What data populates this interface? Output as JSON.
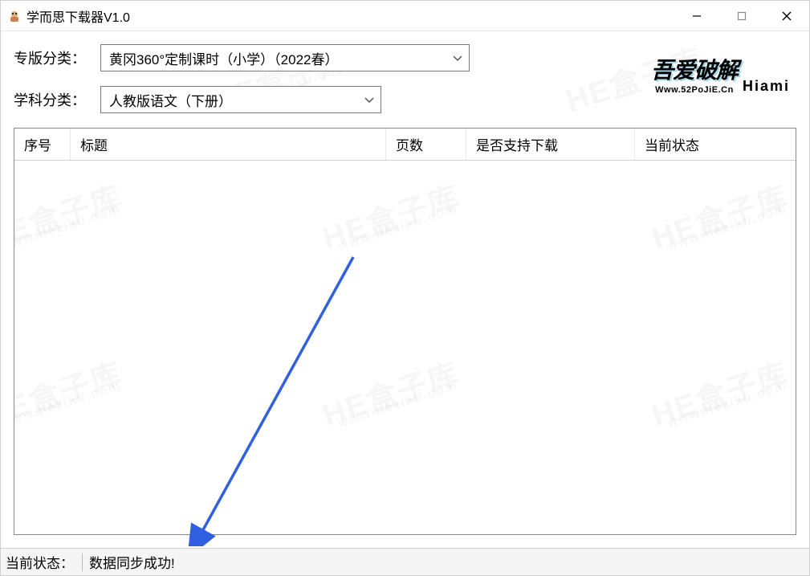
{
  "window": {
    "title": "学而思下载器V1.0"
  },
  "filters": {
    "category_label": "专版分类：",
    "category_value": "黄冈360°定制课时（小学）（2022春）",
    "subject_label": "学科分类：",
    "subject_value": "人教版语文（下册）"
  },
  "logo": {
    "main": "吾爱破解",
    "sub": "Www.52PoJiE.Cn",
    "author": "Hiami"
  },
  "table": {
    "columns": {
      "seq": "序号",
      "title": "标题",
      "pages": "页数",
      "download_support": "是否支持下载",
      "status": "当前状态"
    }
  },
  "status_bar": {
    "label": "当前状态：",
    "message": "数据同步成功!"
  },
  "watermark": {
    "text": "HE盒子库",
    "url": "www.heziku.com"
  }
}
